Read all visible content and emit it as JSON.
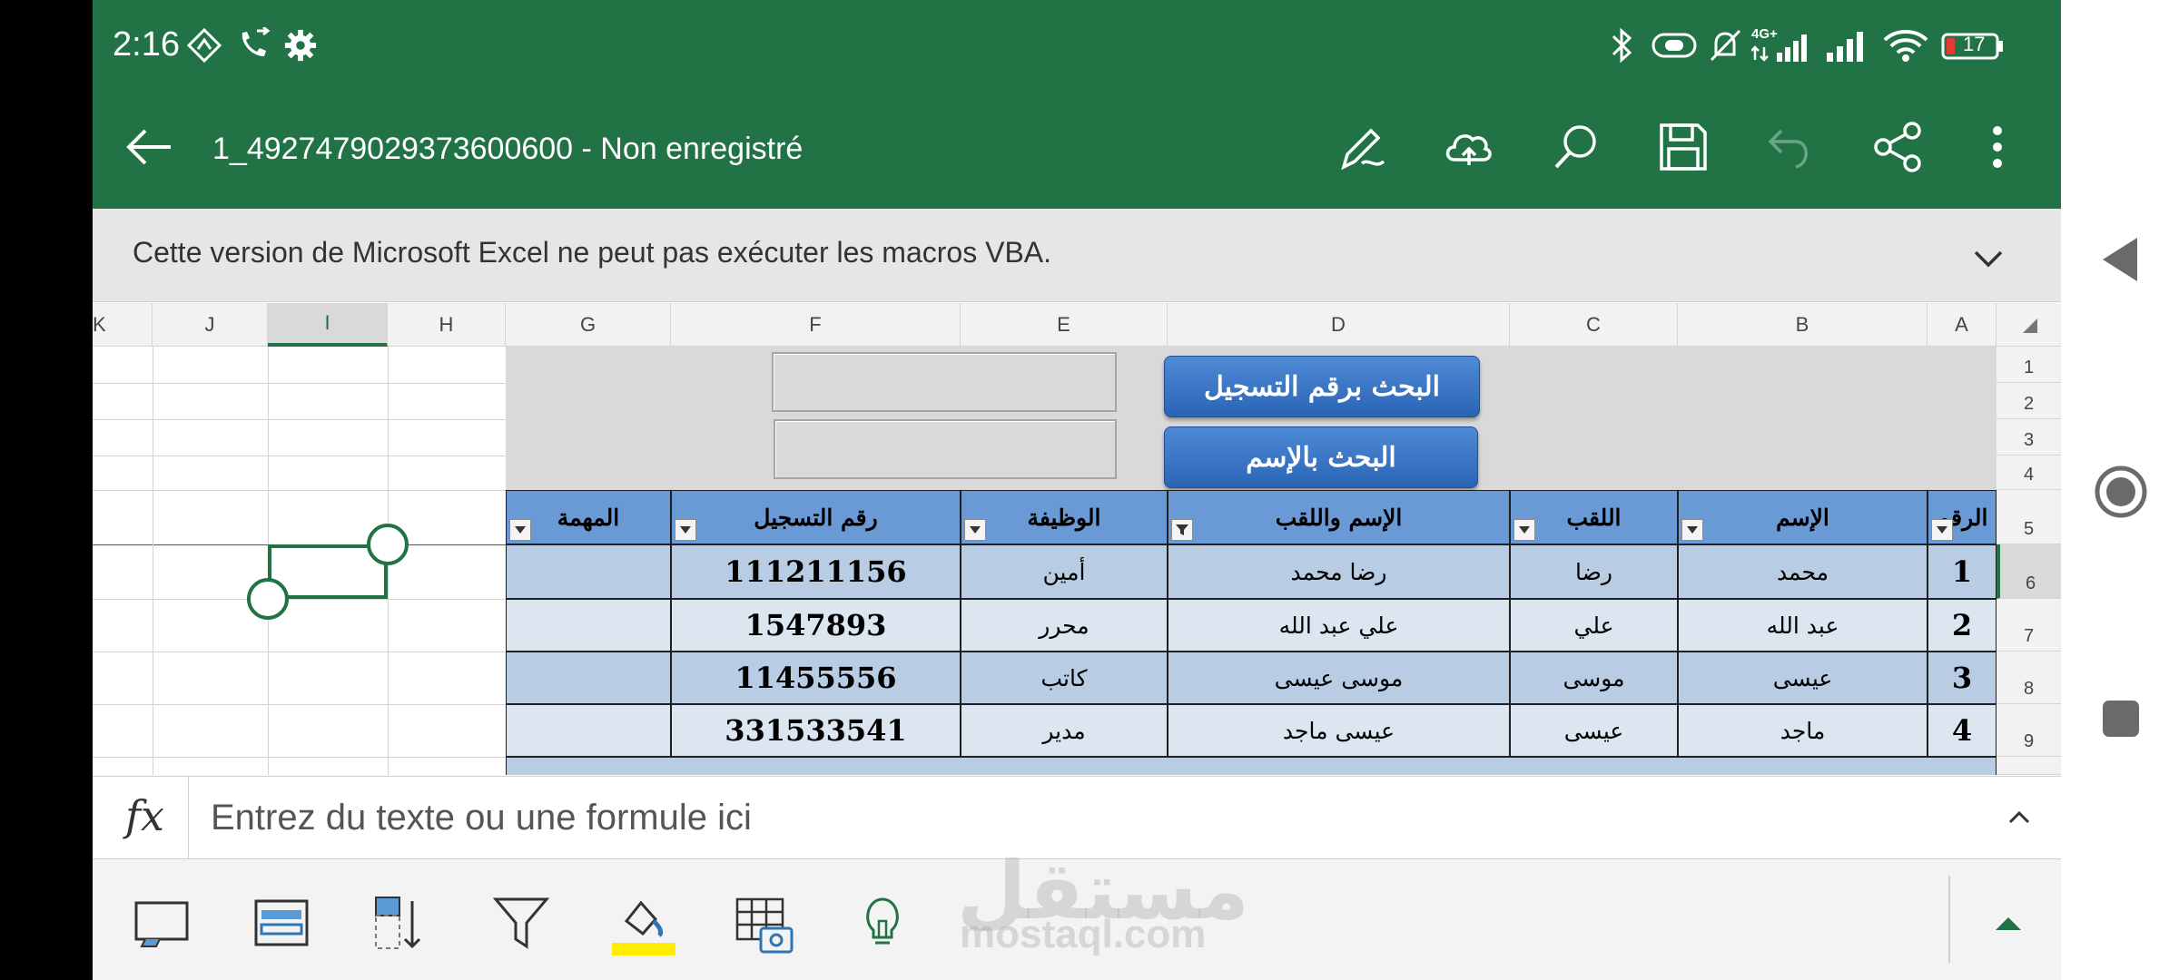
{
  "status_bar": {
    "time": "2:16",
    "battery": "17",
    "network": "4G+"
  },
  "title_bar": {
    "doc_title": "1_4927479029373600600 - Non enregistré"
  },
  "message_bar": {
    "text": "Cette version de Microsoft Excel ne peut pas exécuter les macros VBA."
  },
  "column_headers": [
    "K",
    "J",
    "I",
    "H",
    "G",
    "F",
    "E",
    "D",
    "C",
    "B",
    "A"
  ],
  "selected_column": "I",
  "row_headers": [
    "1",
    "2",
    "3",
    "4",
    "5",
    "6",
    "7",
    "8",
    "9"
  ],
  "selected_row": "6",
  "buttons": {
    "search_by_reg": "البحث برقم التسجيل",
    "search_by_name": "البحث بالإسم"
  },
  "table": {
    "headers": [
      "الرقم",
      "الإسم",
      "اللقب",
      "الإسم واللقب",
      "الوظيفة",
      "رقم التسجيل",
      "المهمة"
    ],
    "rows": [
      [
        "1",
        "محمد",
        "رضا",
        "رضا محمد",
        "أمين",
        "111211156",
        ""
      ],
      [
        "2",
        "عبد الله",
        "علي",
        "علي عبد الله",
        "محرر",
        "1547893",
        ""
      ],
      [
        "3",
        "عيسى",
        "موسى",
        "موسى عيسى",
        "كاتب",
        "11455556",
        ""
      ],
      [
        "4",
        "ماجد",
        "عيسى",
        "عيسى ماجد",
        "مدير",
        "331533541",
        ""
      ]
    ]
  },
  "formula_bar": {
    "fx_label": "fx",
    "placeholder": "Entrez du texte ou une formule ici"
  },
  "watermark": {
    "arabic": "مستقل",
    "latin": "mostaql.com"
  },
  "colors": {
    "excel_green": "#217346",
    "table_header": "#6a9ad6",
    "row_odd": "#b8cce4",
    "row_even": "#dce6f1",
    "button_blue": "#2a64b5",
    "highlight_yellow": "#ffee00"
  },
  "icons": {
    "status": [
      "nav-diamond-icon",
      "call-forward-icon",
      "settings-icon",
      "bluetooth-icon",
      "data-saver-icon",
      "bell-off-icon",
      "signal-4g-icon",
      "signal-icon",
      "wifi-icon",
      "battery-icon"
    ],
    "toolbar": [
      "pen-icon",
      "cloud-upload-icon",
      "search-icon",
      "save-icon",
      "undo-icon",
      "share-icon",
      "more-vert-icon"
    ],
    "bottom": [
      "cell-box-icon",
      "wrap-text-icon",
      "sort-icon",
      "filter-icon",
      "fill-color-icon",
      "table-camera-icon",
      "lightbulb-icon",
      "expand-up-icon"
    ],
    "nav": [
      "back-triangle-icon",
      "home-circle-icon",
      "recents-square-icon"
    ]
  }
}
